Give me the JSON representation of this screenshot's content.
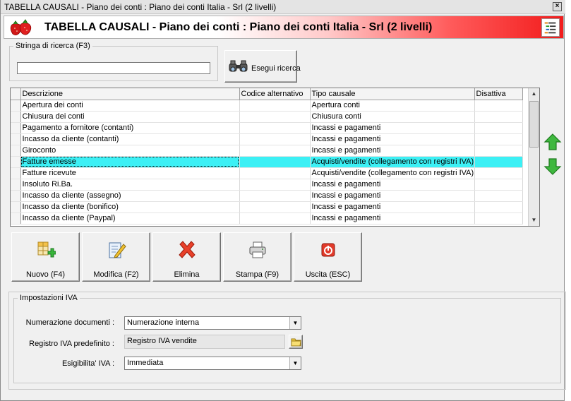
{
  "window": {
    "title": "TABELLA CAUSALI - Piano dei conti : Piano dei conti Italia - Srl (2 livelli)",
    "close_glyph": "×"
  },
  "banner": {
    "title": "TABELLA CAUSALI - Piano dei conti : Piano dei conti Italia - Srl (2 livelli)",
    "accent": "#f21b1b"
  },
  "search": {
    "legend": "Stringa di ricerca (F3)",
    "value": "",
    "button_label": "Esegui ricerca"
  },
  "grid": {
    "columns": [
      "Descrizione",
      "Codice alternativo",
      "Tipo causale",
      "Disattiva"
    ],
    "rows": [
      {
        "desc": "Apertura dei conti",
        "code": "",
        "type": "Apertura conti",
        "disattiva": ""
      },
      {
        "desc": "Chiusura dei conti",
        "code": "",
        "type": "Chiusura conti",
        "disattiva": ""
      },
      {
        "desc": "Pagamento a fornitore (contanti)",
        "code": "",
        "type": "Incassi e pagamenti",
        "disattiva": ""
      },
      {
        "desc": "Incasso da cliente (contanti)",
        "code": "",
        "type": "Incassi e pagamenti",
        "disattiva": ""
      },
      {
        "desc": "Giroconto",
        "code": "",
        "type": "Incassi e pagamenti",
        "disattiva": ""
      },
      {
        "desc": "Fatture emesse",
        "code": "",
        "type": "Acquisti/vendite (collegamento con registri IVA)",
        "disattiva": ""
      },
      {
        "desc": "Fatture ricevute",
        "code": "",
        "type": "Acquisti/vendite (collegamento con registri IVA)",
        "disattiva": ""
      },
      {
        "desc": "Insoluto Ri.Ba.",
        "code": "",
        "type": "Incassi e pagamenti",
        "disattiva": ""
      },
      {
        "desc": "Incasso da cliente (assegno)",
        "code": "",
        "type": "Incassi e pagamenti",
        "disattiva": ""
      },
      {
        "desc": "Incasso da cliente (bonifico)",
        "code": "",
        "type": "Incassi e pagamenti",
        "disattiva": ""
      },
      {
        "desc": "Incasso da cliente (Paypal)",
        "code": "",
        "type": "Incassi e pagamenti",
        "disattiva": ""
      }
    ],
    "selected_index": 5,
    "selection_color": "#3cf0f5"
  },
  "actions": {
    "nuovo": "Nuovo (F4)",
    "modifica": "Modifica (F2)",
    "elimina": "Elimina",
    "stampa": "Stampa (F9)",
    "uscita": "Uscita (ESC)"
  },
  "iva": {
    "legend": "Impostazioni IVA",
    "numerazione_label": "Numerazione documenti :",
    "numerazione_value": "Numerazione interna",
    "registro_label": "Registro IVA predefinito :",
    "registro_value": "Registro IVA vendite",
    "esigibilita_label": "Esigibilita' IVA :",
    "esigibilita_value": "Immediata"
  },
  "icons": [
    "strawberry-logo-icon",
    "list-icon",
    "binoculars-icon",
    "arrow-up-icon",
    "arrow-down-icon",
    "new-grid-icon",
    "edit-document-icon",
    "delete-x-icon",
    "printer-icon",
    "power-icon",
    "folder-icon",
    "chevron-down-icon"
  ]
}
